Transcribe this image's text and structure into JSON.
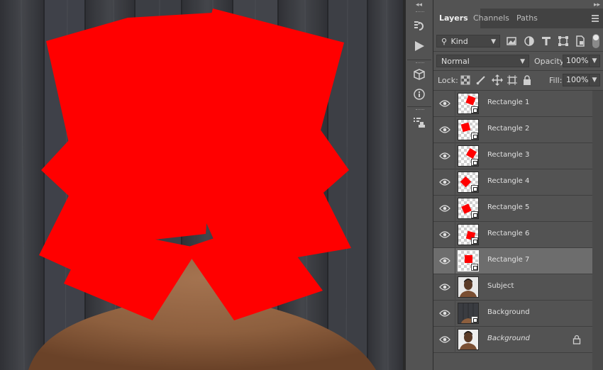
{
  "panel": {
    "tabs": [
      {
        "label": "Layers",
        "active": true
      },
      {
        "label": "Channels",
        "active": false
      },
      {
        "label": "Paths",
        "active": false
      }
    ],
    "filter": {
      "kind_label": "Kind"
    },
    "blend_mode": "Normal",
    "opacity_label": "Opacity:",
    "opacity_value": "100%",
    "lock_label": "Lock:",
    "fill_label": "Fill:",
    "fill_value": "100%"
  },
  "layers": [
    {
      "name": "Rectangle 1",
      "type": "shape",
      "selected": false
    },
    {
      "name": "Rectangle 2",
      "type": "shape",
      "selected": false
    },
    {
      "name": "Rectangle 3",
      "type": "shape",
      "selected": false
    },
    {
      "name": "Rectangle 4",
      "type": "shape",
      "selected": false
    },
    {
      "name": "Rectangle 5",
      "type": "shape",
      "selected": false
    },
    {
      "name": "Rectangle 6",
      "type": "shape",
      "selected": false
    },
    {
      "name": "Rectangle 7",
      "type": "shape",
      "selected": true
    },
    {
      "name": "Subject",
      "type": "photo-subject",
      "selected": false
    },
    {
      "name": "Background",
      "type": "photo-smartobject",
      "selected": false
    },
    {
      "name": "Background",
      "type": "photo-locked",
      "selected": false,
      "locked": true,
      "italic": true
    }
  ],
  "icons": {
    "strip": [
      "history-icon",
      "play-actions-icon",
      "3d-cube-icon",
      "info-icon",
      "properties-icon"
    ],
    "filters": [
      "image-filter-icon",
      "adjustment-filter-icon",
      "type-filter-icon",
      "shape-filter-icon",
      "smartobject-filter-icon"
    ],
    "lock": [
      "lock-transparent-icon",
      "lock-paint-icon",
      "lock-position-icon",
      "lock-artboard-icon",
      "lock-all-icon"
    ]
  },
  "colors": {
    "shape_fill": "#ff0000",
    "panel_bg": "#535353",
    "selected_layer": "#6d6d6d"
  }
}
